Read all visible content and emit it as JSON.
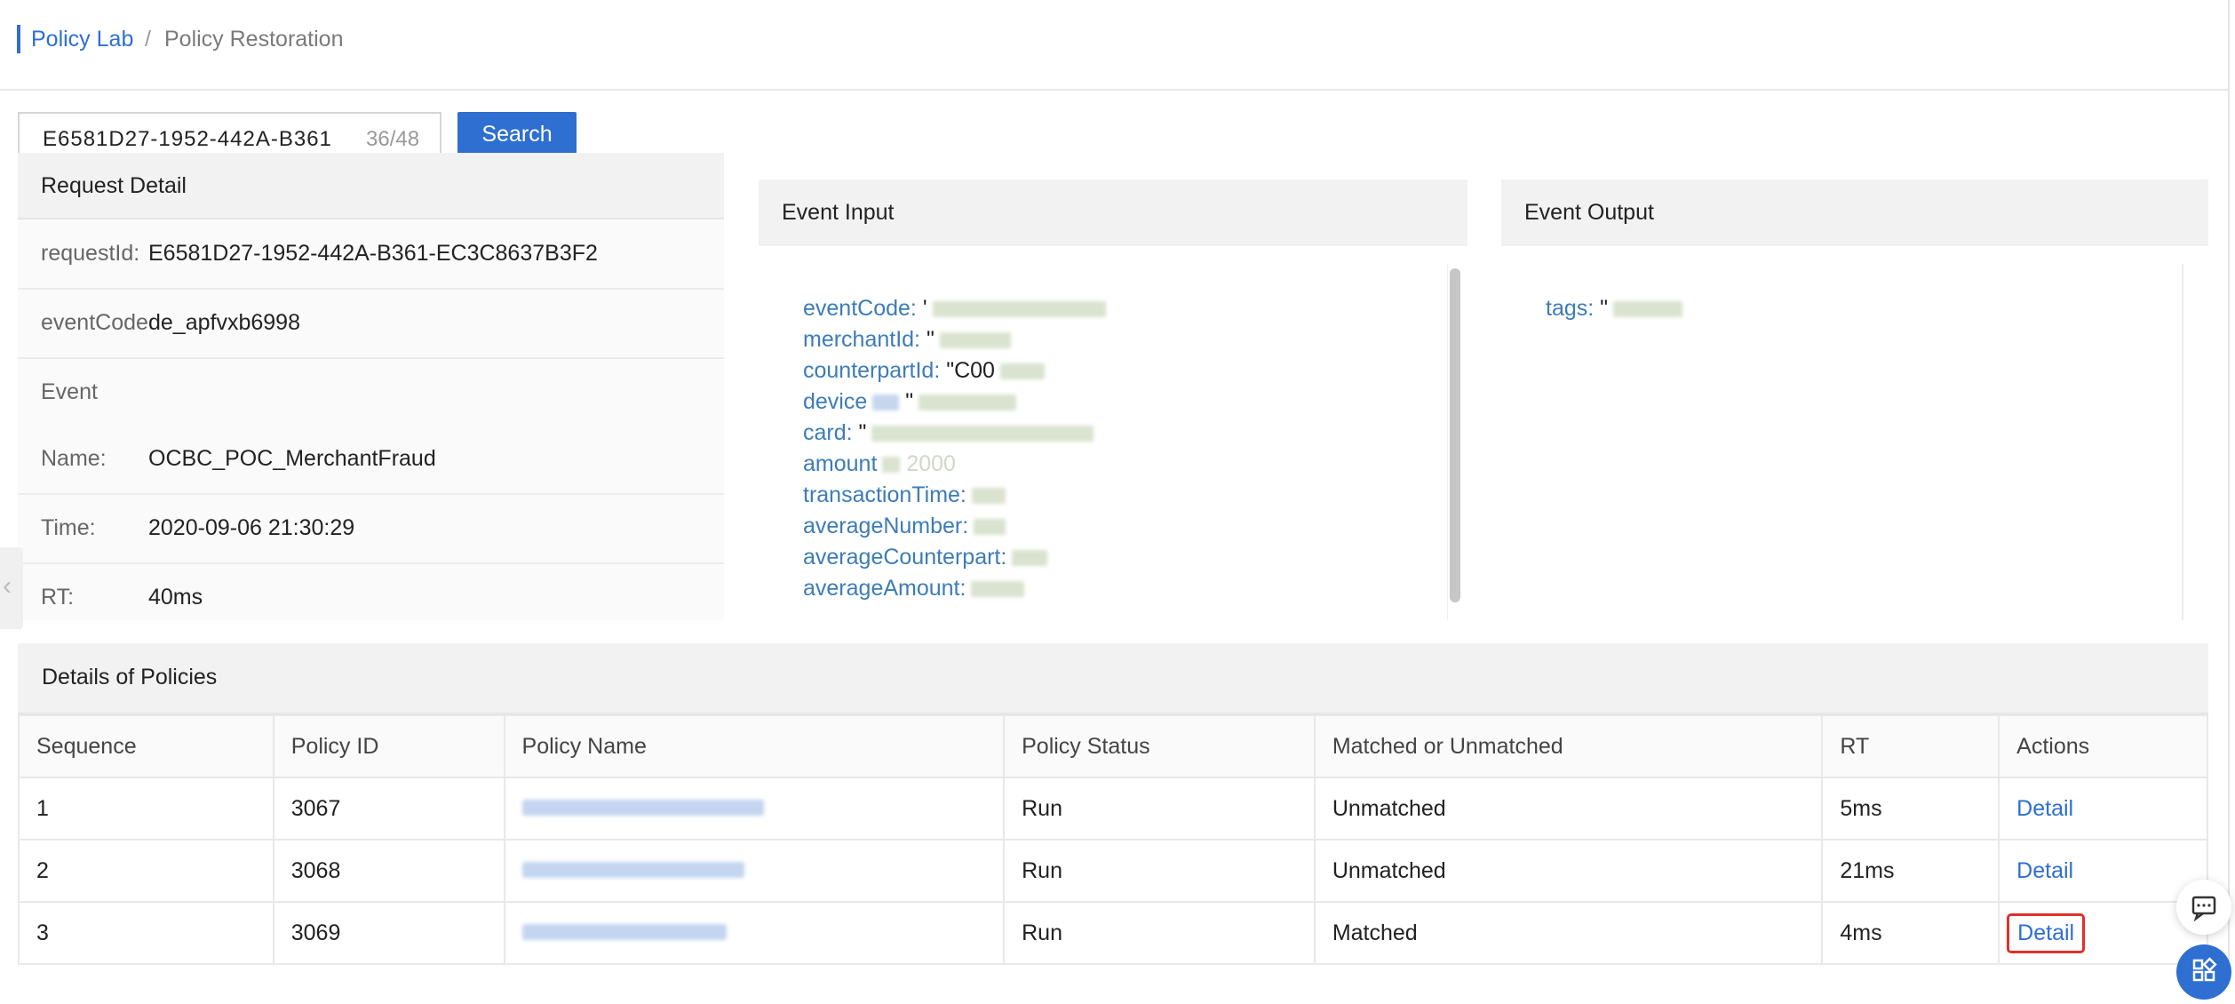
{
  "breadcrumb": {
    "root": "Policy Lab",
    "separator": "/",
    "current": "Policy Restoration"
  },
  "search": {
    "value": "E6581D27-1952-442A-B361",
    "count": "36/48",
    "button": "Search"
  },
  "request_detail": {
    "title": "Request Detail",
    "rows": [
      {
        "key": "requestId:",
        "value": "E6581D27-1952-442A-B361-EC3C8637B3F2"
      },
      {
        "key": "eventCode",
        "value": "de_apfvxb6998"
      },
      {
        "key": "Event",
        "value": ""
      },
      {
        "key": "Name:",
        "value": "OCBC_POC_MerchantFraud"
      },
      {
        "key": "Time:",
        "value": "2020-09-06 21:30:29"
      },
      {
        "key": "RT:",
        "value": "40ms"
      }
    ]
  },
  "event_input": {
    "title": "Event Input",
    "fields": [
      {
        "key": "eventCode:",
        "value": "'"
      },
      {
        "key": "merchantId:",
        "value": "\""
      },
      {
        "key": "counterpartId:",
        "value": "\"C00"
      },
      {
        "key": "device",
        "value": "\""
      },
      {
        "key": "card:",
        "value": "\""
      },
      {
        "key": "amount",
        "value": "2000"
      },
      {
        "key": "transactionTime:",
        "value": ""
      },
      {
        "key": "averageNumber:",
        "value": ""
      },
      {
        "key": "averageCounterpart:",
        "value": ""
      },
      {
        "key": "averageAmount:",
        "value": ""
      }
    ]
  },
  "event_output": {
    "title": "Event Output",
    "fields": [
      {
        "key": "tags:",
        "value": "\""
      }
    ]
  },
  "policies": {
    "title": "Details of Policies",
    "columns": [
      "Sequence",
      "Policy ID",
      "Policy Name",
      "Policy Status",
      "Matched or Unmatched",
      "RT",
      "Actions"
    ],
    "rows": [
      {
        "sequence": "1",
        "policy_id": "3067",
        "policy_name": "",
        "status": "Run",
        "match": "Unmatched",
        "rt": "5ms",
        "action": "Detail"
      },
      {
        "sequence": "2",
        "policy_id": "3068",
        "policy_name": "",
        "status": "Run",
        "match": "Unmatched",
        "rt": "21ms",
        "action": "Detail"
      },
      {
        "sequence": "3",
        "policy_id": "3069",
        "policy_name": "",
        "status": "Run",
        "match": "Matched",
        "rt": "4ms",
        "action": "Detail"
      }
    ]
  },
  "colors": {
    "accent": "#2e6fd1",
    "matched": "#52c41a",
    "highlight": "#e0302a"
  },
  "icons": {
    "collapse": "chevron-left-icon",
    "chat": "chat-icon",
    "apps": "apps-icon"
  }
}
